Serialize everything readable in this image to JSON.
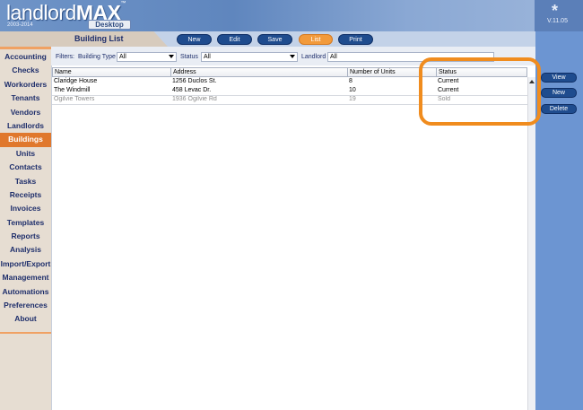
{
  "app": {
    "logo_text_a": "landlord",
    "logo_text_b": "MAX",
    "logo_tm": "™",
    "logo_years": "2003-2014",
    "logo_edition": "Desktop",
    "version": "V.11.05",
    "version_icon": "*"
  },
  "page": {
    "title": "Building List"
  },
  "toolbar": {
    "buttons": [
      {
        "label": "New",
        "active": false
      },
      {
        "label": "Edit",
        "active": false
      },
      {
        "label": "Save",
        "active": false
      },
      {
        "label": "List",
        "active": true
      },
      {
        "label": "Print",
        "active": false
      }
    ]
  },
  "sidebar": {
    "items": [
      {
        "label": "Accounting",
        "active": false
      },
      {
        "label": "Checks",
        "active": false
      },
      {
        "label": "Workorders",
        "active": false
      },
      {
        "label": "Tenants",
        "active": false
      },
      {
        "label": "Vendors",
        "active": false
      },
      {
        "label": "Landlords",
        "active": false
      },
      {
        "label": "Buildings",
        "active": true
      },
      {
        "label": "Units",
        "active": false
      },
      {
        "label": "Contacts",
        "active": false
      },
      {
        "label": "Tasks",
        "active": false
      },
      {
        "label": "Receipts",
        "active": false
      },
      {
        "label": "Invoices",
        "active": false
      },
      {
        "label": "Templates",
        "active": false
      },
      {
        "label": "Reports",
        "active": false
      },
      {
        "label": "Analysis",
        "active": false
      },
      {
        "label": "Import/Export",
        "active": false
      },
      {
        "label": "Management",
        "active": false
      },
      {
        "label": "Automations",
        "active": false
      },
      {
        "label": "Preferences",
        "active": false
      },
      {
        "label": "About",
        "active": false
      }
    ]
  },
  "filters": {
    "label": "Filters:",
    "building_type_label": "Building Type",
    "building_type_value": "All",
    "status_label": "Status",
    "status_value": "All",
    "landlord_label": "Landlord",
    "landlord_value": "All"
  },
  "table": {
    "columns": [
      "Name",
      "Address",
      "Number of Units",
      "Status"
    ],
    "rows": [
      {
        "name": "Claridge House",
        "address": "1256 Duclos St.",
        "units": "8",
        "status": "Current"
      },
      {
        "name": "The Windmill",
        "address": "458 Levac Dr.",
        "units": "10",
        "status": "Current"
      },
      {
        "name": "Ogilvie Towers",
        "address": "1936 Ogilvie Rd",
        "units": "19",
        "status": "Sold"
      }
    ]
  },
  "side_actions": {
    "buttons": [
      "View",
      "New",
      "Delete"
    ]
  },
  "colors": {
    "accent_orange": "#e0782d",
    "highlight_orange": "#f08c1e",
    "nav_text": "#1e2e6b",
    "button_blue": "#1f4c8e",
    "header_blue": "#6f94c7"
  }
}
